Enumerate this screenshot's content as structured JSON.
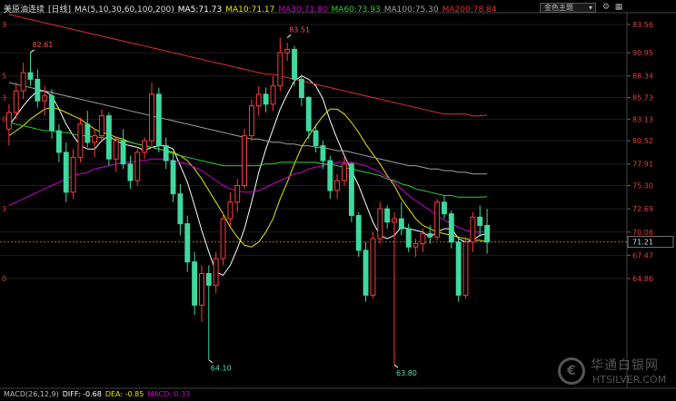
{
  "header": {
    "title": "美原油连续",
    "period": "[日线]",
    "ma_params": "MA(5,10,30,60,100,200)",
    "ma5": "MA5:71.73",
    "ma10": "MA10:71.17",
    "ma30": "MA30:71.80",
    "ma60": "MA60:73.93",
    "ma100": "MA100:75.30",
    "ma200": "MA200:78.84",
    "theme_select": "金色主题",
    "colors": {
      "ma5": "#ffffff",
      "ma10": "#e6e600",
      "ma30": "#d000d0",
      "ma60": "#33cc33",
      "ma100": "#a0a0a0",
      "ma200": "#e03030"
    }
  },
  "macd": {
    "label": "MACD(26,12,9)",
    "diff": "DIFF: -0.68",
    "dea": "DEA: -0.85",
    "macd": "MACD: 0.33",
    "colors": {
      "label": "#bbbbbb",
      "diff": "#ffffff",
      "dea": "#e6e600",
      "macd": "#d000d0"
    }
  },
  "watermark": {
    "text": "华通白银网",
    "sub": "HTSILVER.COM",
    "logo": "coin-logo"
  },
  "chart_data": {
    "type": "candlestick",
    "ylim": [
      62.5,
      84.9
    ],
    "right_ticks": [
      "83.56",
      "90.95",
      "88.34",
      "85.73",
      "83.13",
      "80.52",
      "77.91",
      "75.30",
      "72.69",
      "70.08",
      "67.47",
      "64.86"
    ],
    "right_tick_values": [
      84.3,
      82.6,
      81.2,
      79.9,
      78.6,
      77.3,
      75.9,
      74.6,
      73.2,
      71.8,
      70.4,
      69.0
    ],
    "left_ticks": [
      "3",
      "",
      "5",
      "3",
      "0",
      "",
      "",
      "",
      "3",
      "",
      "",
      "0"
    ],
    "current_price": "71.21",
    "current_value": 71.21,
    "annotations": [
      {
        "text": "82.61",
        "index": 3,
        "value": 82.61
      },
      {
        "text": "83.51",
        "index": 39,
        "value": 83.51
      },
      {
        "text": "64.10",
        "index": 28,
        "value": 64.1
      },
      {
        "text": "63.80",
        "index": 54,
        "value": 63.8
      }
    ],
    "candles": [
      [
        78.0,
        79.5,
        77.0,
        79.0
      ],
      [
        79.0,
        80.8,
        78.6,
        80.3
      ],
      [
        80.3,
        82.0,
        79.8,
        81.4
      ],
      [
        81.4,
        82.61,
        80.6,
        81.0
      ],
      [
        81.0,
        81.6,
        79.3,
        79.7
      ],
      [
        79.7,
        80.6,
        78.8,
        80.0
      ],
      [
        80.0,
        80.4,
        77.4,
        77.9
      ],
      [
        77.9,
        78.3,
        76.0,
        76.6
      ],
      [
        76.6,
        77.2,
        73.6,
        74.2
      ],
      [
        74.2,
        76.8,
        73.8,
        76.3
      ],
      [
        76.3,
        78.7,
        76.0,
        78.3
      ],
      [
        78.3,
        79.1,
        76.9,
        77.2
      ],
      [
        77.2,
        78.0,
        76.3,
        77.6
      ],
      [
        77.6,
        79.2,
        77.2,
        78.8
      ],
      [
        78.8,
        79.0,
        75.8,
        76.2
      ],
      [
        76.2,
        77.6,
        75.4,
        77.3
      ],
      [
        77.3,
        78.0,
        75.6,
        75.9
      ],
      [
        75.9,
        76.4,
        74.4,
        74.9
      ],
      [
        74.9,
        76.8,
        74.6,
        76.6
      ],
      [
        76.6,
        77.5,
        76.2,
        77.3
      ],
      [
        77.3,
        80.8,
        77.0,
        80.1
      ],
      [
        80.1,
        80.5,
        76.6,
        77.0
      ],
      [
        77.0,
        77.5,
        75.6,
        76.1
      ],
      [
        76.1,
        76.6,
        73.6,
        74.1
      ],
      [
        74.1,
        74.7,
        71.6,
        72.3
      ],
      [
        72.3,
        72.8,
        69.4,
        70.0
      ],
      [
        70.0,
        70.6,
        66.8,
        67.4
      ],
      [
        67.4,
        69.8,
        66.4,
        69.3
      ],
      [
        69.3,
        69.8,
        64.1,
        68.6
      ],
      [
        68.6,
        70.6,
        68.1,
        70.2
      ],
      [
        70.2,
        73.0,
        69.8,
        72.6
      ],
      [
        72.6,
        74.2,
        72.1,
        73.6
      ],
      [
        73.6,
        75.0,
        73.0,
        74.6
      ],
      [
        74.6,
        78.0,
        74.4,
        77.6
      ],
      [
        77.6,
        79.8,
        77.3,
        79.4
      ],
      [
        79.4,
        80.6,
        78.8,
        80.1
      ],
      [
        80.1,
        80.5,
        79.0,
        79.5
      ],
      [
        79.5,
        81.2,
        79.1,
        80.6
      ],
      [
        80.6,
        83.51,
        80.3,
        82.6
      ],
      [
        82.6,
        83.2,
        82.1,
        82.8
      ],
      [
        82.8,
        83.0,
        80.6,
        81.0
      ],
      [
        81.0,
        81.3,
        79.4,
        79.9
      ],
      [
        79.9,
        80.0,
        77.4,
        77.9
      ],
      [
        77.9,
        78.3,
        76.6,
        77.0
      ],
      [
        77.0,
        77.3,
        75.6,
        76.1
      ],
      [
        76.1,
        76.4,
        73.8,
        74.3
      ],
      [
        74.3,
        75.3,
        73.8,
        74.9
      ],
      [
        74.9,
        76.3,
        74.6,
        75.9
      ],
      [
        75.9,
        76.0,
        72.4,
        72.8
      ],
      [
        72.8,
        73.0,
        70.3,
        70.7
      ],
      [
        70.7,
        71.2,
        67.6,
        68.0
      ],
      [
        68.0,
        71.8,
        67.8,
        71.4
      ],
      [
        71.4,
        73.6,
        71.1,
        73.2
      ],
      [
        73.2,
        73.4,
        72.0,
        72.4
      ],
      [
        72.4,
        73.0,
        63.8,
        72.6
      ],
      [
        72.6,
        73.6,
        71.6,
        72.0
      ],
      [
        72.0,
        72.3,
        70.6,
        70.9
      ],
      [
        70.9,
        71.4,
        70.3,
        71.1
      ],
      [
        71.1,
        72.0,
        70.6,
        71.7
      ],
      [
        71.7,
        72.2,
        71.1,
        71.5
      ],
      [
        71.5,
        73.8,
        71.3,
        73.6
      ],
      [
        73.6,
        74.0,
        72.6,
        72.9
      ],
      [
        72.9,
        73.1,
        70.8,
        71.2
      ],
      [
        71.2,
        71.5,
        67.6,
        68.0
      ],
      [
        68.0,
        71.5,
        67.8,
        71.2
      ],
      [
        71.2,
        73.0,
        70.6,
        72.7
      ],
      [
        72.7,
        73.4,
        71.5,
        72.2
      ],
      [
        72.2,
        73.2,
        70.5,
        71.2
      ]
    ],
    "ma_series": [
      {
        "name": "MA5",
        "color": "#ffffff",
        "values": [
          78.2,
          78.8,
          79.4,
          79.9,
          80.3,
          80.3,
          80.0,
          79.2,
          78.3,
          77.6,
          77.0,
          76.8,
          76.8,
          77.3,
          77.6,
          77.3,
          77.1,
          77.0,
          76.9,
          76.7,
          76.9,
          77.0,
          77.0,
          76.8,
          75.8,
          74.8,
          73.4,
          71.9,
          70.6,
          69.4,
          69.2,
          69.8,
          70.8,
          72.0,
          73.6,
          75.4,
          76.8,
          78.0,
          79.2,
          80.1,
          80.9,
          81.2,
          81.0,
          80.6,
          79.8,
          78.5,
          77.4,
          76.4,
          75.5,
          74.6,
          73.5,
          72.4,
          71.6,
          71.4,
          71.6,
          72.1,
          72.0,
          71.9,
          71.8,
          71.5,
          71.8,
          72.0,
          72.0,
          71.4,
          71.2,
          71.3,
          71.6,
          71.7
        ]
      },
      {
        "name": "MA10",
        "color": "#e6e600",
        "values": [
          77.6,
          77.9,
          78.2,
          78.6,
          78.9,
          79.2,
          79.3,
          79.2,
          79.0,
          78.8,
          78.6,
          78.3,
          78.0,
          77.8,
          77.7,
          77.5,
          77.4,
          77.2,
          77.1,
          77.0,
          76.9,
          76.8,
          76.7,
          76.6,
          76.4,
          76.1,
          75.6,
          75.0,
          74.3,
          73.6,
          72.9,
          72.1,
          71.5,
          71.0,
          70.9,
          71.2,
          71.8,
          72.6,
          73.8,
          74.8,
          75.9,
          76.9,
          77.6,
          78.2,
          78.8,
          79.2,
          79.2,
          78.9,
          78.4,
          77.8,
          77.1,
          76.5,
          75.9,
          75.2,
          74.6,
          73.8,
          73.2,
          72.6,
          72.2,
          72.0,
          71.8,
          71.7,
          71.6,
          71.5,
          71.4,
          71.3,
          71.3,
          71.2
        ]
      },
      {
        "name": "MA30",
        "color": "#d000d0",
        "values": [
          73.4,
          73.6,
          73.8,
          74.0,
          74.2,
          74.4,
          74.6,
          74.8,
          75.0,
          75.2,
          75.3,
          75.4,
          75.6,
          75.7,
          75.8,
          75.9,
          76.0,
          76.0,
          76.1,
          76.1,
          76.2,
          76.2,
          76.2,
          76.1,
          76.0,
          75.9,
          75.7,
          75.5,
          75.2,
          74.9,
          74.6,
          74.4,
          74.3,
          74.2,
          74.2,
          74.3,
          74.5,
          74.7,
          74.9,
          75.1,
          75.3,
          75.4,
          75.6,
          75.7,
          75.8,
          75.9,
          76.0,
          76.0,
          76.0,
          75.9,
          75.8,
          75.6,
          75.4,
          75.1,
          74.8,
          74.4,
          74.0,
          73.7,
          73.4,
          73.1,
          72.8,
          72.5,
          72.3,
          72.1,
          71.9,
          71.8,
          71.8,
          71.8
        ]
      },
      {
        "name": "MA60",
        "color": "#33cc33",
        "values": [
          78.4,
          78.3,
          78.2,
          78.1,
          78.0,
          77.9,
          77.9,
          77.8,
          77.8,
          77.7,
          77.6,
          77.6,
          77.5,
          77.5,
          77.4,
          77.4,
          77.3,
          77.2,
          77.1,
          77.0,
          76.9,
          76.8,
          76.7,
          76.5,
          76.4,
          76.3,
          76.2,
          76.1,
          76.0,
          75.9,
          75.8,
          75.8,
          75.8,
          75.8,
          75.8,
          75.8,
          75.9,
          75.9,
          76.0,
          76.0,
          76.0,
          76.0,
          76.0,
          76.0,
          75.9,
          75.9,
          75.8,
          75.7,
          75.6,
          75.5,
          75.4,
          75.3,
          75.2,
          75.0,
          74.9,
          74.7,
          74.6,
          74.4,
          74.3,
          74.2,
          74.1,
          74.0,
          74.0,
          73.9,
          73.9,
          73.9,
          73.9,
          73.93
        ]
      },
      {
        "name": "MA100",
        "color": "#a0a0a0",
        "values": [
          80.8,
          80.7,
          80.6,
          80.5,
          80.4,
          80.3,
          80.2,
          80.1,
          80.0,
          79.9,
          79.8,
          79.7,
          79.6,
          79.5,
          79.4,
          79.3,
          79.2,
          79.1,
          79.0,
          78.9,
          78.8,
          78.7,
          78.6,
          78.5,
          78.4,
          78.3,
          78.2,
          78.1,
          78.0,
          77.9,
          77.8,
          77.7,
          77.6,
          77.5,
          77.4,
          77.4,
          77.3,
          77.2,
          77.2,
          77.1,
          77.1,
          77.0,
          77.0,
          76.9,
          76.9,
          76.8,
          76.7,
          76.7,
          76.6,
          76.5,
          76.4,
          76.3,
          76.2,
          76.1,
          76.0,
          75.9,
          75.8,
          75.8,
          75.7,
          75.6,
          75.6,
          75.5,
          75.5,
          75.4,
          75.4,
          75.3,
          75.3,
          75.3
        ]
      },
      {
        "name": "MA200",
        "color": "#e03030",
        "values": [
          84.9,
          84.8,
          84.7,
          84.6,
          84.5,
          84.4,
          84.3,
          84.2,
          84.1,
          84.0,
          83.9,
          83.8,
          83.7,
          83.6,
          83.5,
          83.4,
          83.3,
          83.2,
          83.1,
          83.0,
          82.9,
          82.8,
          82.7,
          82.6,
          82.5,
          82.4,
          82.3,
          82.2,
          82.1,
          82.0,
          81.9,
          81.8,
          81.7,
          81.6,
          81.5,
          81.4,
          81.3,
          81.3,
          81.2,
          81.1,
          81.0,
          80.9,
          80.8,
          80.7,
          80.6,
          80.5,
          80.4,
          80.3,
          80.2,
          80.1,
          80.0,
          79.9,
          79.8,
          79.7,
          79.6,
          79.5,
          79.4,
          79.3,
          79.2,
          79.1,
          79.0,
          78.9,
          78.9,
          78.9,
          78.9,
          78.8,
          78.8,
          78.84
        ]
      }
    ]
  }
}
